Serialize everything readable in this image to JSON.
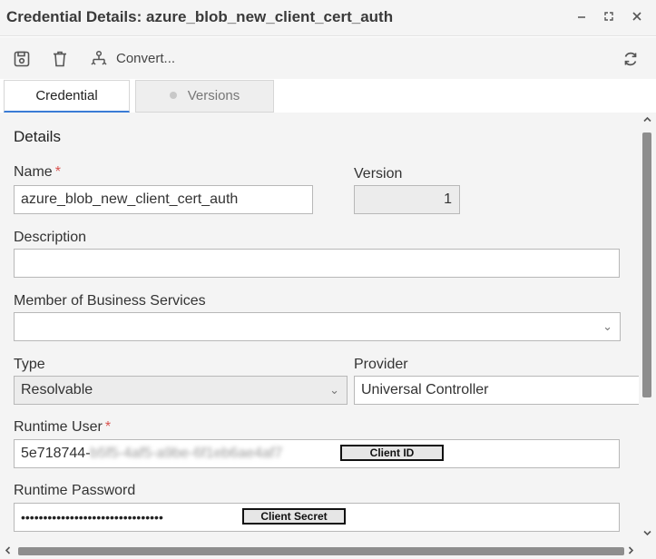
{
  "window": {
    "title": "Credential Details: azure_blob_new_client_cert_auth",
    "minimize_icon": "minimize-icon",
    "maximize_icon": "maximize-icon",
    "close_icon": "close-icon"
  },
  "toolbar": {
    "save_icon": "save-icon",
    "delete_icon": "trash-icon",
    "convert_icon": "convert-icon",
    "convert_label": "Convert...",
    "refresh_icon": "refresh-icon"
  },
  "tabs": [
    {
      "label": "Credential",
      "active": true
    },
    {
      "label": "Versions",
      "active": false
    }
  ],
  "details": {
    "section_title": "Details",
    "name_label": "Name",
    "name_required": "*",
    "name_value": "azure_blob_new_client_cert_auth",
    "version_label": "Version",
    "version_value": "1",
    "description_label": "Description",
    "description_value": "",
    "member_label": "Member of Business Services",
    "member_value": "",
    "type_label": "Type",
    "type_value": "Resolvable",
    "provider_label": "Provider",
    "provider_value": "Universal Controller",
    "runtime_user_label": "Runtime User",
    "runtime_user_required": "*",
    "runtime_user_value": "5e718744-",
    "runtime_user_redacted": "b5f5-4af5-a9be-6f1eb6ae4af7",
    "runtime_user_tag": "Client ID",
    "runtime_password_label": "Runtime Password",
    "runtime_password_value": "••••••••••••••••••••••••••••••••",
    "runtime_password_tag": "Client Secret"
  },
  "colors": {
    "accent": "#3a7bd5",
    "required": "#d9534f",
    "panel_bg": "#f4f4f4",
    "scroll_thumb": "#8e8e8e"
  }
}
